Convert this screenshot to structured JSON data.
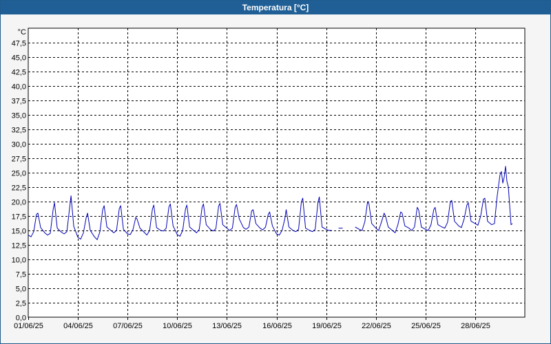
{
  "window": {
    "title": "Temperatura [°C]"
  },
  "chart_data": {
    "type": "line",
    "title": "Temperatura [°C]",
    "ylabel": "°C",
    "xlabel": "",
    "ylim": [
      0,
      50
    ],
    "yticks": [
      0,
      2.5,
      5,
      7.5,
      10,
      12.5,
      15,
      17.5,
      20,
      22.5,
      25,
      27.5,
      30,
      32.5,
      35,
      37.5,
      40,
      42.5,
      45,
      47.5
    ],
    "ytick_labels": [
      "0,0",
      "2,5",
      "5,0",
      "7,5",
      "10,0",
      "12,5",
      "15,0",
      "17,5",
      "20,0",
      "22,5",
      "25,0",
      "27,5",
      "30,0",
      "32,5",
      "35,0",
      "37,5",
      "40,0",
      "42,5",
      "45,0",
      "47,5"
    ],
    "xlim": [
      "2025-06-01",
      "2025-07-01"
    ],
    "xticks": [
      "2025-06-01",
      "2025-06-04",
      "2025-06-07",
      "2025-06-10",
      "2025-06-13",
      "2025-06-16",
      "2025-06-19",
      "2025-06-22",
      "2025-06-25",
      "2025-06-28"
    ],
    "xtick_labels": [
      "01/06/25",
      "04/06/25",
      "07/06/25",
      "10/06/25",
      "13/06/25",
      "16/06/25",
      "19/06/25",
      "22/06/25",
      "25/06/25",
      "28/06/25"
    ],
    "grid": true,
    "line_color": "#0000b4",
    "series": [
      {
        "name": "",
        "points": [
          [
            "2025-06-01T00:00",
            14.2
          ],
          [
            "2025-06-01T04:00",
            13.9
          ],
          [
            "2025-06-01T08:00",
            14.8
          ],
          [
            "2025-06-01T12:00",
            17.8
          ],
          [
            "2025-06-01T14:00",
            18.0
          ],
          [
            "2025-06-01T18:00",
            15.5
          ],
          [
            "2025-06-02T00:00",
            14.6
          ],
          [
            "2025-06-02T04:00",
            14.2
          ],
          [
            "2025-06-02T08:00",
            14.5
          ],
          [
            "2025-06-02T12:00",
            18.6
          ],
          [
            "2025-06-02T14:00",
            19.8
          ],
          [
            "2025-06-02T18:00",
            15.4
          ],
          [
            "2025-06-03T00:00",
            14.7
          ],
          [
            "2025-06-03T04:00",
            14.4
          ],
          [
            "2025-06-03T08:00",
            14.8
          ],
          [
            "2025-06-03T12:00",
            18.9
          ],
          [
            "2025-06-03T14:00",
            21.0
          ],
          [
            "2025-06-03T18:00",
            15.7
          ],
          [
            "2025-06-04T00:00",
            13.8
          ],
          [
            "2025-06-04T04:00",
            13.5
          ],
          [
            "2025-06-04T08:00",
            14.6
          ],
          [
            "2025-06-04T12:00",
            17.2
          ],
          [
            "2025-06-04T14:00",
            18.0
          ],
          [
            "2025-06-04T18:00",
            15.0
          ],
          [
            "2025-06-05T00:00",
            13.9
          ],
          [
            "2025-06-05T04:00",
            13.4
          ],
          [
            "2025-06-05T08:00",
            14.8
          ],
          [
            "2025-06-05T12:00",
            18.6
          ],
          [
            "2025-06-05T14:00",
            19.3
          ],
          [
            "2025-06-05T18:00",
            15.6
          ],
          [
            "2025-06-06T00:00",
            15.0
          ],
          [
            "2025-06-06T04:00",
            14.6
          ],
          [
            "2025-06-06T08:00",
            15.0
          ],
          [
            "2025-06-06T12:00",
            18.8
          ],
          [
            "2025-06-06T14:00",
            19.3
          ],
          [
            "2025-06-06T18:00",
            15.2
          ],
          [
            "2025-06-07T00:00",
            14.4
          ],
          [
            "2025-06-07T04:00",
            14.3
          ],
          [
            "2025-06-07T08:00",
            15.2
          ],
          [
            "2025-06-07T12:00",
            17.3
          ],
          [
            "2025-06-07T14:00",
            16.9
          ],
          [
            "2025-06-07T18:00",
            15.4
          ],
          [
            "2025-06-08T00:00",
            14.7
          ],
          [
            "2025-06-08T04:00",
            14.2
          ],
          [
            "2025-06-08T08:00",
            15.0
          ],
          [
            "2025-06-08T12:00",
            18.7
          ],
          [
            "2025-06-08T14:00",
            19.4
          ],
          [
            "2025-06-08T18:00",
            15.5
          ],
          [
            "2025-06-09T00:00",
            15.0
          ],
          [
            "2025-06-09T04:00",
            14.9
          ],
          [
            "2025-06-09T08:00",
            15.4
          ],
          [
            "2025-06-09T12:00",
            19.1
          ],
          [
            "2025-06-09T14:00",
            19.6
          ],
          [
            "2025-06-09T18:00",
            15.8
          ],
          [
            "2025-06-10T00:00",
            14.3
          ],
          [
            "2025-06-10T04:00",
            14.0
          ],
          [
            "2025-06-10T08:00",
            15.0
          ],
          [
            "2025-06-10T12:00",
            18.7
          ],
          [
            "2025-06-10T14:00",
            19.4
          ],
          [
            "2025-06-10T18:00",
            15.6
          ],
          [
            "2025-06-11T00:00",
            15.0
          ],
          [
            "2025-06-11T04:00",
            14.6
          ],
          [
            "2025-06-11T08:00",
            15.2
          ],
          [
            "2025-06-11T12:00",
            19.0
          ],
          [
            "2025-06-11T14:00",
            19.6
          ],
          [
            "2025-06-11T18:00",
            16.0
          ],
          [
            "2025-06-12T00:00",
            15.2
          ],
          [
            "2025-06-12T04:00",
            14.9
          ],
          [
            "2025-06-12T08:00",
            15.3
          ],
          [
            "2025-06-12T12:00",
            19.2
          ],
          [
            "2025-06-12T14:00",
            19.7
          ],
          [
            "2025-06-12T18:00",
            16.0
          ],
          [
            "2025-06-13T00:00",
            15.4
          ],
          [
            "2025-06-13T04:00",
            15.0
          ],
          [
            "2025-06-13T08:00",
            15.4
          ],
          [
            "2025-06-13T12:00",
            19.0
          ],
          [
            "2025-06-13T14:00",
            19.5
          ],
          [
            "2025-06-13T18:00",
            17.0
          ],
          [
            "2025-06-14T00:00",
            15.5
          ],
          [
            "2025-06-14T04:00",
            15.2
          ],
          [
            "2025-06-14T08:00",
            15.6
          ],
          [
            "2025-06-14T12:00",
            18.4
          ],
          [
            "2025-06-14T14:00",
            18.6
          ],
          [
            "2025-06-14T18:00",
            16.2
          ],
          [
            "2025-06-15T00:00",
            15.4
          ],
          [
            "2025-06-15T04:00",
            15.1
          ],
          [
            "2025-06-15T08:00",
            15.6
          ],
          [
            "2025-06-15T12:00",
            17.8
          ],
          [
            "2025-06-15T14:00",
            18.2
          ],
          [
            "2025-06-15T18:00",
            15.8
          ],
          [
            "2025-06-16T00:00",
            14.4
          ],
          [
            "2025-06-16T04:00",
            14.2
          ],
          [
            "2025-06-16T08:00",
            15.0
          ],
          [
            "2025-06-16T12:00",
            17.0
          ],
          [
            "2025-06-16T14:00",
            18.6
          ],
          [
            "2025-06-16T18:00",
            15.6
          ],
          [
            "2025-06-17T00:00",
            15.0
          ],
          [
            "2025-06-17T04:00",
            14.8
          ],
          [
            "2025-06-17T08:00",
            15.2
          ],
          [
            "2025-06-17T12:00",
            20.0
          ],
          [
            "2025-06-17T14:00",
            20.6
          ],
          [
            "2025-06-17T18:00",
            15.4
          ],
          [
            "2025-06-18T00:00",
            15.0
          ],
          [
            "2025-06-18T04:00",
            14.8
          ],
          [
            "2025-06-18T08:00",
            15.2
          ],
          [
            "2025-06-18T12:00",
            19.8
          ],
          [
            "2025-06-18T14:00",
            20.8
          ],
          [
            "2025-06-18T18:00",
            15.6
          ],
          [
            "2025-06-19T00:00",
            15.2
          ],
          [
            "2025-06-19T04:00",
            15.0
          ],
          [
            "2025-06-19T08:00",
            15.0
          ],
          null,
          [
            "2025-06-19T18:00",
            15.4
          ],
          [
            "2025-06-20T00:00",
            15.4
          ],
          null,
          [
            "2025-06-20T18:00",
            15.6
          ],
          [
            "2025-06-21T00:00",
            15.2
          ],
          [
            "2025-06-21T04:00",
            15.0
          ],
          [
            "2025-06-21T08:00",
            16.5
          ],
          [
            "2025-06-21T12:00",
            20.0
          ],
          [
            "2025-06-21T14:00",
            19.6
          ],
          [
            "2025-06-21T18:00",
            16.2
          ],
          [
            "2025-06-22T00:00",
            15.4
          ],
          [
            "2025-06-22T04:00",
            15.0
          ],
          [
            "2025-06-22T08:00",
            16.4
          ],
          [
            "2025-06-22T12:00",
            18.0
          ],
          [
            "2025-06-22T14:00",
            17.5
          ],
          [
            "2025-06-22T18:00",
            15.6
          ],
          [
            "2025-06-23T00:00",
            15.0
          ],
          [
            "2025-06-23T04:00",
            14.6
          ],
          [
            "2025-06-23T08:00",
            16.0
          ],
          [
            "2025-06-23T12:00",
            18.2
          ],
          [
            "2025-06-23T14:00",
            18.0
          ],
          [
            "2025-06-23T18:00",
            15.8
          ],
          [
            "2025-06-24T00:00",
            15.4
          ],
          [
            "2025-06-24T04:00",
            15.0
          ],
          [
            "2025-06-24T08:00",
            15.6
          ],
          [
            "2025-06-24T12:00",
            19.0
          ],
          [
            "2025-06-24T14:00",
            18.6
          ],
          [
            "2025-06-24T18:00",
            15.6
          ],
          [
            "2025-06-25T00:00",
            15.2
          ],
          [
            "2025-06-25T04:00",
            15.0
          ],
          [
            "2025-06-25T08:00",
            16.0
          ],
          [
            "2025-06-25T12:00",
            18.6
          ],
          [
            "2025-06-25T14:00",
            19.0
          ],
          [
            "2025-06-25T18:00",
            16.0
          ],
          [
            "2025-06-26T00:00",
            15.6
          ],
          [
            "2025-06-26T04:00",
            15.4
          ],
          [
            "2025-06-26T08:00",
            16.4
          ],
          [
            "2025-06-26T12:00",
            20.0
          ],
          [
            "2025-06-26T14:00",
            20.2
          ],
          [
            "2025-06-26T18:00",
            16.6
          ],
          [
            "2025-06-27T00:00",
            15.8
          ],
          [
            "2025-06-27T04:00",
            15.5
          ],
          [
            "2025-06-27T08:00",
            17.0
          ],
          [
            "2025-06-27T12:00",
            19.4
          ],
          [
            "2025-06-27T14:00",
            19.8
          ],
          [
            "2025-06-27T18:00",
            16.6
          ],
          [
            "2025-06-28T00:00",
            16.2
          ],
          [
            "2025-06-28T04:00",
            15.9
          ],
          [
            "2025-06-28T08:00",
            17.5
          ],
          [
            "2025-06-28T12:00",
            20.4
          ],
          [
            "2025-06-28T14:00",
            20.6
          ],
          [
            "2025-06-28T18:00",
            16.6
          ],
          [
            "2025-06-29T00:00",
            16.0
          ],
          [
            "2025-06-29T04:00",
            16.2
          ],
          [
            "2025-06-29T08:00",
            21.0
          ],
          [
            "2025-06-29T12:00",
            24.6
          ],
          [
            "2025-06-29T14:00",
            25.2
          ],
          [
            "2025-06-29T16:00",
            23.2
          ],
          [
            "2025-06-29T18:00",
            24.2
          ],
          [
            "2025-06-29T20:00",
            26.1
          ],
          [
            "2025-06-29T22:00",
            23.5
          ],
          [
            "2025-06-30T00:00",
            22.6
          ],
          [
            "2025-06-30T04:00",
            16.0
          ],
          [
            "2025-06-30T06:00",
            16.2
          ]
        ]
      }
    ]
  }
}
